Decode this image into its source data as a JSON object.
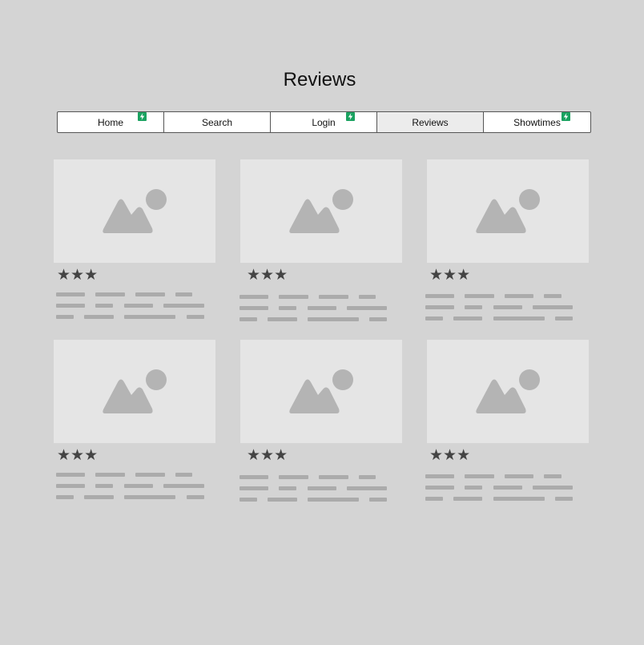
{
  "page": {
    "title": "Reviews"
  },
  "nav": {
    "tabs": [
      {
        "label": "Home",
        "badge": "lightning-badge-icon"
      },
      {
        "label": "Search"
      },
      {
        "label": "Login",
        "badge": "lightning-badge-icon"
      },
      {
        "label": "Reviews",
        "selected": true
      },
      {
        "label": "Showtimes",
        "badge": "lightning-badge-icon"
      }
    ]
  },
  "colors": {
    "background": "#d4d4d4",
    "placeholder": "#e5e5e5",
    "placeholder_icon": "#b4b4b4",
    "badge": "#1aa260",
    "stars": "#444444",
    "text_lines": "#ababab"
  },
  "cards": [
    {
      "image": "image-placeholder-icon",
      "stars": "★★★",
      "rating": 3
    },
    {
      "image": "image-placeholder-icon",
      "stars": "★★★",
      "rating": 3
    },
    {
      "image": "image-placeholder-icon",
      "stars": "★★★",
      "rating": 3
    },
    {
      "image": "image-placeholder-icon",
      "stars": "★★★",
      "rating": 3
    },
    {
      "image": "image-placeholder-icon",
      "stars": "★★★",
      "rating": 3
    },
    {
      "image": "image-placeholder-icon",
      "stars": "★★★",
      "rating": 3
    }
  ]
}
